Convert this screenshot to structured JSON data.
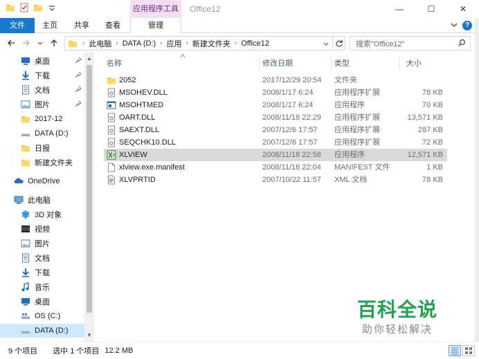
{
  "titlebar": {
    "context_tab_header": "应用程序工具",
    "window_title": "Office12",
    "minimize": "—",
    "maximize": "☐",
    "close": "✕"
  },
  "ribbon": {
    "tabs": [
      {
        "label": "文件"
      },
      {
        "label": "主页"
      },
      {
        "label": "共享"
      },
      {
        "label": "查看"
      },
      {
        "label": "管理"
      }
    ],
    "help": "?"
  },
  "address": {
    "crumbs": [
      "此电脑",
      "DATA (D:)",
      "应用",
      "新建文件夹",
      "Office12"
    ],
    "search_placeholder": "搜索\"Office12\""
  },
  "nav": {
    "items": [
      {
        "label": "桌面",
        "icon": "desktop-icon",
        "pinned": true
      },
      {
        "label": "下载",
        "icon": "download-icon",
        "pinned": true
      },
      {
        "label": "文档",
        "icon": "document-icon",
        "pinned": true
      },
      {
        "label": "图片",
        "icon": "pictures-icon",
        "pinned": true
      },
      {
        "label": "2017-12",
        "icon": "folder-icon",
        "pinned": false
      },
      {
        "label": "DATA (D:)",
        "icon": "drive-icon",
        "pinned": false
      },
      {
        "label": "日报",
        "icon": "folder-icon",
        "pinned": false
      },
      {
        "label": "新建文件夹",
        "icon": "folder-icon",
        "pinned": false
      },
      {
        "label": "OneDrive",
        "icon": "onedrive-icon",
        "pinned": false
      },
      {
        "label": "此电脑",
        "icon": "computer-icon",
        "pinned": false
      },
      {
        "label": "3D 对象",
        "icon": "3d-objects-icon",
        "pinned": false
      },
      {
        "label": "视频",
        "icon": "video-icon",
        "pinned": false
      },
      {
        "label": "图片",
        "icon": "pictures-icon",
        "pinned": false
      },
      {
        "label": "文档",
        "icon": "document-icon",
        "pinned": false
      },
      {
        "label": "下载",
        "icon": "download-icon",
        "pinned": false
      },
      {
        "label": "音乐",
        "icon": "music-icon",
        "pinned": false
      },
      {
        "label": "桌面",
        "icon": "desktop-icon",
        "pinned": false
      },
      {
        "label": "OS (C:)",
        "icon": "drive-icon",
        "pinned": false
      },
      {
        "label": "DATA (D:)",
        "icon": "drive-icon",
        "pinned": false
      }
    ]
  },
  "columns": {
    "name": "名称",
    "date": "修改日期",
    "type": "类型",
    "size": "大小"
  },
  "files": [
    {
      "name": "2052",
      "date": "2017/12/29 20:54",
      "type": "文件夹",
      "size": "",
      "icon": "folder-icon"
    },
    {
      "name": "MSOHEV.DLL",
      "date": "2008/1/17 6:24",
      "type": "应用程序扩展",
      "size": "78 KB",
      "icon": "dll-icon"
    },
    {
      "name": "MSOHTMED",
      "date": "2008/1/17 6:24",
      "type": "应用程序",
      "size": "70 KB",
      "icon": "exe-icon"
    },
    {
      "name": "OART.DLL",
      "date": "2008/11/18 22:29",
      "type": "应用程序扩展",
      "size": "13,571 KB",
      "icon": "dll-icon"
    },
    {
      "name": "SAEXT.DLL",
      "date": "2007/12/6 17:57",
      "type": "应用程序扩展",
      "size": "287 KB",
      "icon": "dll-icon"
    },
    {
      "name": "SEQCHK10.DLL",
      "date": "2007/12/6 17:57",
      "type": "应用程序扩展",
      "size": "72 KB",
      "icon": "dll-icon"
    },
    {
      "name": "XLVIEW",
      "date": "2008/11/18 22:58",
      "type": "应用程序",
      "size": "12,571 KB",
      "icon": "excel-viewer-icon"
    },
    {
      "name": "xlview.exe.manifest",
      "date": "2008/11/18 22:04",
      "type": "MANIFEST 文件",
      "size": "1 KB",
      "icon": "file-icon"
    },
    {
      "name": "XLVPRTID",
      "date": "2007/10/22 11:57",
      "type": "XML 文档",
      "size": "78 KB",
      "icon": "xml-icon"
    }
  ],
  "status": {
    "count": "9 个项目",
    "selected": "选中 1 个项目",
    "size": "12.2 MB"
  },
  "watermark": {
    "title": "百科全说",
    "subtitle": "助你轻松解决"
  },
  "colors": {
    "accent": "#1979ca",
    "selection": "#cde8ff",
    "context_tab": "#f3def2",
    "watermark": "#1ea34c"
  }
}
